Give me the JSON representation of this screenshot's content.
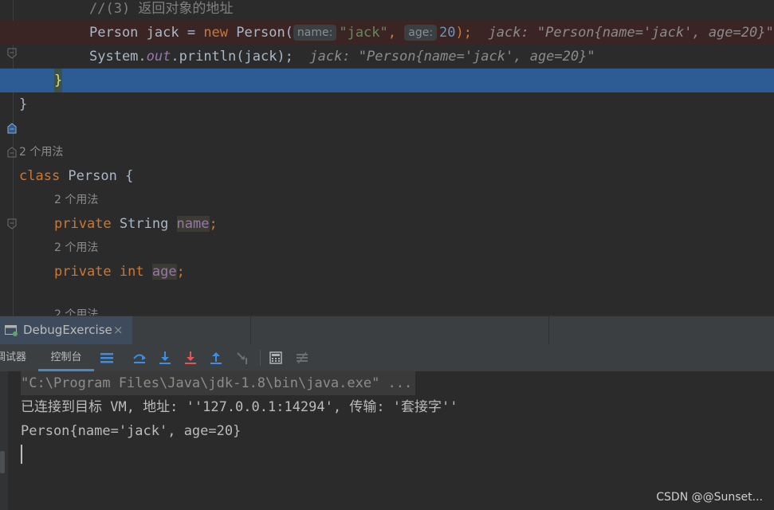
{
  "editor": {
    "comment": "//(3) 返回对象的地址",
    "line_jack": {
      "type": "Person",
      "var": " jack = ",
      "new_kw": "new",
      "ctor": " Person(",
      "hint_name": "name:",
      "arg1": "\"jack\"",
      "comma": ", ",
      "hint_age": "age:",
      "arg2": "20",
      "end": ");",
      "inline": "  jack: \"Person{name='jack', age=20}\""
    },
    "line_print": {
      "pre": "System.",
      "out": "out",
      "call": ".println(jack);",
      "inline": "  jack: \"Person{name='jack', age=20}\""
    },
    "close_method": "}",
    "close_class": "}",
    "usages": "2 个用法",
    "class_decl": {
      "kw": "class",
      "name": " Person {"
    },
    "field_name": {
      "kw": "private",
      "type": " String ",
      "id": "name",
      "semi": ";"
    },
    "field_age": {
      "kw": "private",
      "type_kw": " int",
      "id": "age",
      "semi": ";"
    }
  },
  "tool_window": {
    "tab_title": "DebugExercise",
    "tab_close": "×",
    "tab_debugger": "调试器",
    "tab_console": "控制台"
  },
  "toolbar_icons": [
    "console-list-icon",
    "step-over-icon",
    "step-into-icon",
    "force-step-into-icon",
    "step-out-icon",
    "run-to-cursor-icon",
    "evaluate-icon",
    "trace-icon"
  ],
  "console": {
    "line1": "\"C:\\Program Files\\Java\\jdk-1.8\\bin\\java.exe\" ...",
    "line2": "已连接到目标 VM, 地址: ''127.0.0.1:14294', 传输: '套接字''",
    "line3": "Person{name='jack', age=20}"
  },
  "watermark": "CSDN @@Sunset...",
  "colors": {
    "editor_bg": "#2b2b2b",
    "keyword": "#cc7832",
    "string": "#6a8759",
    "number": "#6897bb",
    "field": "#9876aa",
    "selection": "#2d5b94",
    "error_line": "#3b2424"
  }
}
